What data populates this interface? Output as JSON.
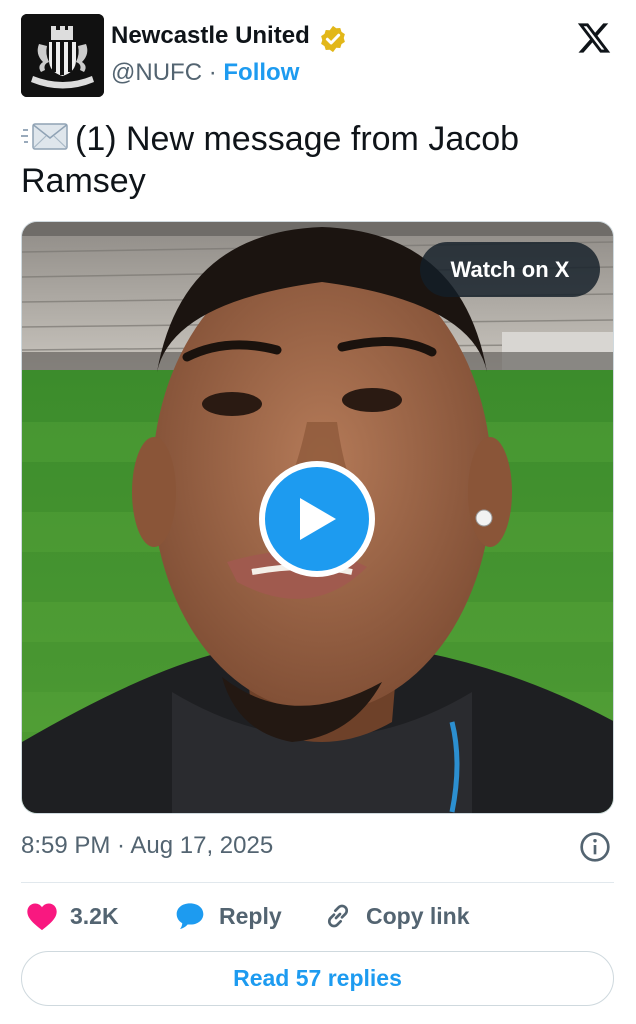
{
  "header": {
    "author_name": "Newcastle United",
    "handle": "@NUFC",
    "separator": "·",
    "follow_label": "Follow",
    "avatar_icon": "newcastle-crest",
    "badge_icon": "verified-gold-badge",
    "platform_icon": "x-logo"
  },
  "tweet": {
    "text": "(1) New message from Jacob Ramsey",
    "leading_icon": "incoming-envelope-emoji"
  },
  "media": {
    "watch_label": "Watch on X",
    "play_icon": "play-icon"
  },
  "meta": {
    "timestamp": "8:59 PM · Aug 17, 2025",
    "info_icon": "info-icon"
  },
  "actions": {
    "likes_count": "3.2K",
    "reply_label": "Reply",
    "copy_link_label": "Copy link",
    "read_replies_label": "Read 57 replies"
  },
  "colors": {
    "accent": "#1d9bf0",
    "like": "#f91880",
    "secondary_text": "#536471",
    "badge_gold": "#e2b719"
  }
}
